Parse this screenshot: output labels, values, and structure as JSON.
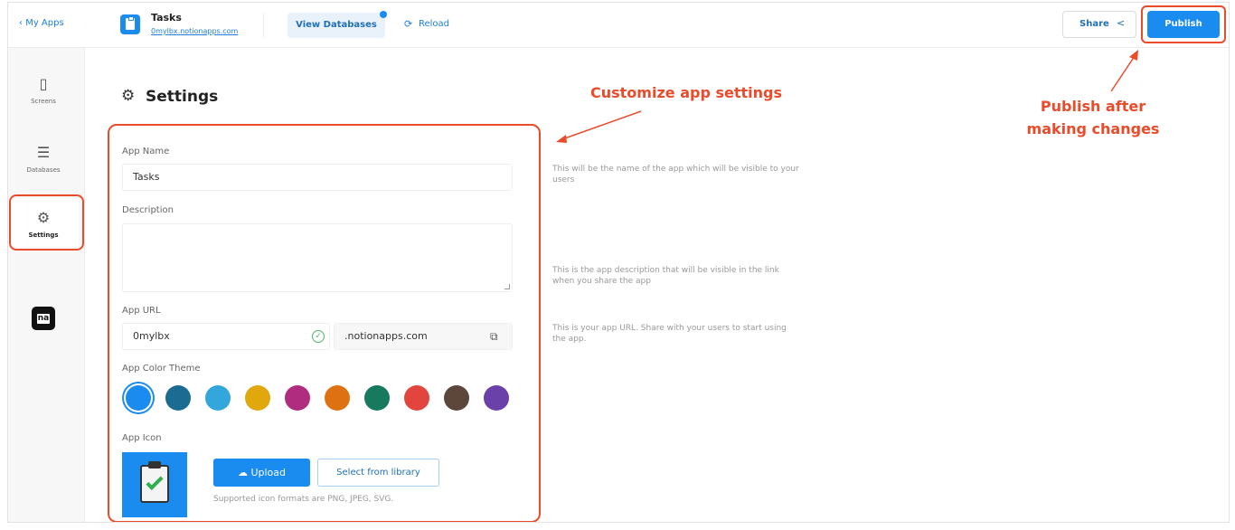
{
  "topbar": {
    "back_label": "My Apps",
    "app_title": "Tasks",
    "app_domain": "0mylbx.notionapps.com",
    "view_databases_label": "View Databases",
    "reload_label": "Reload",
    "share_label": "Share",
    "publish_label": "Publish"
  },
  "sidebar": {
    "items": [
      {
        "label": "Screens",
        "icon": "phone-icon"
      },
      {
        "label": "Databases",
        "icon": "menu-icon"
      },
      {
        "label": "Settings",
        "icon": "gear-icon"
      }
    ],
    "logo_text": "na"
  },
  "settings": {
    "title": "Settings",
    "app_name": {
      "label": "App Name",
      "value": "Tasks",
      "help": "This will be the name of the app which will be visible to your users"
    },
    "description": {
      "label": "Description",
      "value": "",
      "help": "This is the app description that will be visible in the link when you share the app"
    },
    "app_url": {
      "label": "App URL",
      "value": "0mylbx",
      "suffix": ".notionapps.com",
      "help": "This is your app URL. Share with your users to start using the app."
    },
    "color_theme": {
      "label": "App Color Theme",
      "selected_index": 0,
      "colors": [
        "#1a8cf0",
        "#1c6b93",
        "#33a7dc",
        "#e0a80d",
        "#b02c7e",
        "#de7213",
        "#17795e",
        "#e2453d",
        "#5d463a",
        "#6a41a8"
      ]
    },
    "app_icon": {
      "label": "App Icon",
      "upload_label": "Upload",
      "library_label": "Select from library",
      "formats_note": "Supported icon formats are PNG, JPEG, SVG."
    }
  },
  "annotations": {
    "customize": "Customize app settings",
    "publish_line1": "Publish after",
    "publish_line2": "making changes",
    "color": "#ea4b2b"
  }
}
